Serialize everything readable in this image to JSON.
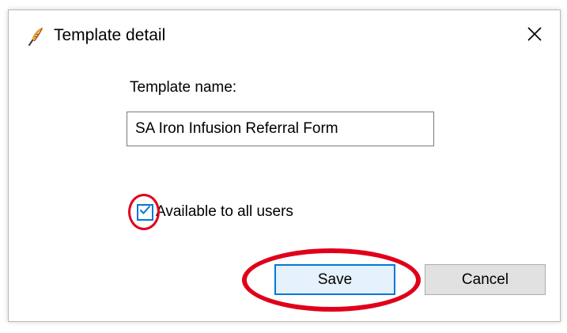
{
  "dialog": {
    "title": "Template detail",
    "app_icon": "feather-quill-icon",
    "close_icon": "close-icon"
  },
  "form": {
    "name_label": "Template name:",
    "name_value": "SA Iron Infusion Referral Form",
    "available_checkbox": {
      "label": "Available to all users",
      "checked": true
    }
  },
  "buttons": {
    "save_label": "Save",
    "cancel_label": "Cancel"
  },
  "colors": {
    "accent": "#0078d7",
    "annotation": "#e0001a",
    "button_face": "#e1e1e1"
  }
}
